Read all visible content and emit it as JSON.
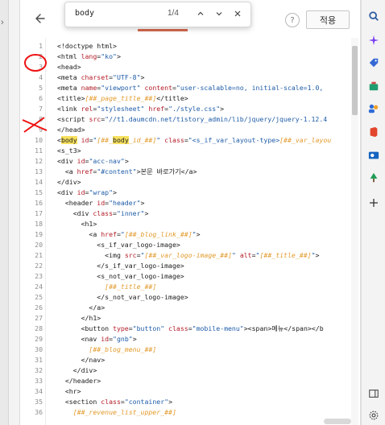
{
  "search": {
    "query": "body",
    "match_count": "1/4"
  },
  "toolbar": {
    "help_label": "?",
    "apply_label": "적용"
  },
  "code_lines": [
    {
      "n": "1",
      "tokens": [
        {
          "t": "tag",
          "v": "<!doctype html>"
        }
      ]
    },
    {
      "n": "2",
      "tokens": [
        {
          "t": "tag",
          "v": "<html "
        },
        {
          "t": "attr",
          "v": "lang"
        },
        {
          "t": "tag",
          "v": "="
        },
        {
          "t": "val",
          "v": "\"ko\""
        },
        {
          "t": "tag",
          "v": ">"
        }
      ]
    },
    {
      "n": "3",
      "tokens": [
        {
          "t": "tag",
          "v": "<head>"
        }
      ]
    },
    {
      "n": "4",
      "tokens": [
        {
          "t": "tag",
          "v": "<meta "
        },
        {
          "t": "attr",
          "v": "charset"
        },
        {
          "t": "tag",
          "v": "="
        },
        {
          "t": "val",
          "v": "\"UTF-8\""
        },
        {
          "t": "tag",
          "v": ">"
        }
      ]
    },
    {
      "n": "5",
      "tokens": [
        {
          "t": "tag",
          "v": "<meta "
        },
        {
          "t": "attr",
          "v": "name"
        },
        {
          "t": "tag",
          "v": "="
        },
        {
          "t": "val",
          "v": "\"viewport\""
        },
        {
          "t": "tag",
          "v": " "
        },
        {
          "t": "attr",
          "v": "content"
        },
        {
          "t": "tag",
          "v": "="
        },
        {
          "t": "val",
          "v": "\"user-scalable=no, initial-scale=1.0,"
        }
      ]
    },
    {
      "n": "6",
      "tokens": [
        {
          "t": "tag",
          "v": "<title>"
        },
        {
          "t": "tpl",
          "v": "[##_page_title_##]"
        },
        {
          "t": "tag",
          "v": "</title>"
        }
      ]
    },
    {
      "n": "7",
      "tokens": [
        {
          "t": "tag",
          "v": "<link "
        },
        {
          "t": "attr",
          "v": "rel"
        },
        {
          "t": "tag",
          "v": "="
        },
        {
          "t": "val",
          "v": "\"stylesheet\""
        },
        {
          "t": "tag",
          "v": " "
        },
        {
          "t": "attr",
          "v": "href"
        },
        {
          "t": "tag",
          "v": "="
        },
        {
          "t": "val",
          "v": "\"./style.css\""
        },
        {
          "t": "tag",
          "v": ">"
        }
      ]
    },
    {
      "n": "8",
      "tokens": [
        {
          "t": "tag",
          "v": "<script "
        },
        {
          "t": "attr",
          "v": "src"
        },
        {
          "t": "tag",
          "v": "="
        },
        {
          "t": "val",
          "v": "\"//t1.daumcdn.net/tistory_admin/lib/jquery/jquery-1.12.4"
        }
      ]
    },
    {
      "n": "9",
      "tokens": [
        {
          "t": "tag",
          "v": "</head>"
        }
      ]
    },
    {
      "n": "10",
      "tokens": [
        {
          "t": "tag",
          "v": "<"
        },
        {
          "t": "hl",
          "v": "body"
        },
        {
          "t": "tag",
          "v": " "
        },
        {
          "t": "attr",
          "v": "id"
        },
        {
          "t": "tag",
          "v": "="
        },
        {
          "t": "val",
          "v": "\""
        },
        {
          "t": "tpl",
          "v": "[##_"
        },
        {
          "t": "hl",
          "v": "body"
        },
        {
          "t": "tpl",
          "v": "_id_##]"
        },
        {
          "t": "val",
          "v": "\""
        },
        {
          "t": "tag",
          "v": " "
        },
        {
          "t": "attr",
          "v": "class"
        },
        {
          "t": "tag",
          "v": "="
        },
        {
          "t": "val",
          "v": "\"<s_if_var_layout-type>"
        },
        {
          "t": "tpl",
          "v": "[##_var_layou"
        }
      ]
    },
    {
      "n": "11",
      "tokens": [
        {
          "t": "tag",
          "v": "<s_t3>"
        }
      ]
    },
    {
      "n": "12",
      "tokens": [
        {
          "t": "tag",
          "v": "<div "
        },
        {
          "t": "attr",
          "v": "id"
        },
        {
          "t": "tag",
          "v": "="
        },
        {
          "t": "val",
          "v": "\"acc-nav\""
        },
        {
          "t": "tag",
          "v": ">"
        }
      ]
    },
    {
      "n": "13",
      "tokens": [
        {
          "t": "tag",
          "v": "  <a "
        },
        {
          "t": "attr",
          "v": "href"
        },
        {
          "t": "tag",
          "v": "="
        },
        {
          "t": "val",
          "v": "\"#content\""
        },
        {
          "t": "tag",
          "v": ">"
        },
        {
          "t": "text",
          "v": "본문 바로가기"
        },
        {
          "t": "tag",
          "v": "</a>"
        }
      ]
    },
    {
      "n": "14",
      "tokens": [
        {
          "t": "tag",
          "v": "</div>"
        }
      ]
    },
    {
      "n": "15",
      "tokens": [
        {
          "t": "tag",
          "v": "<div "
        },
        {
          "t": "attr",
          "v": "id"
        },
        {
          "t": "tag",
          "v": "="
        },
        {
          "t": "val",
          "v": "\"wrap\""
        },
        {
          "t": "tag",
          "v": ">"
        }
      ]
    },
    {
      "n": "16",
      "tokens": [
        {
          "t": "tag",
          "v": "  <header "
        },
        {
          "t": "attr",
          "v": "id"
        },
        {
          "t": "tag",
          "v": "="
        },
        {
          "t": "val",
          "v": "\"header\""
        },
        {
          "t": "tag",
          "v": ">"
        }
      ]
    },
    {
      "n": "17",
      "tokens": [
        {
          "t": "tag",
          "v": "    <div "
        },
        {
          "t": "attr",
          "v": "class"
        },
        {
          "t": "tag",
          "v": "="
        },
        {
          "t": "val",
          "v": "\"inner\""
        },
        {
          "t": "tag",
          "v": ">"
        }
      ]
    },
    {
      "n": "18",
      "tokens": [
        {
          "t": "tag",
          "v": "      <h1>"
        }
      ]
    },
    {
      "n": "19",
      "tokens": [
        {
          "t": "tag",
          "v": "        <a "
        },
        {
          "t": "attr",
          "v": "href"
        },
        {
          "t": "tag",
          "v": "="
        },
        {
          "t": "val",
          "v": "\""
        },
        {
          "t": "tpl",
          "v": "[##_blog_link_##]"
        },
        {
          "t": "val",
          "v": "\""
        },
        {
          "t": "tag",
          "v": ">"
        }
      ]
    },
    {
      "n": "20",
      "tokens": [
        {
          "t": "tag",
          "v": "          <s_if_var_logo-image>"
        }
      ]
    },
    {
      "n": "21",
      "tokens": [
        {
          "t": "tag",
          "v": "            <img "
        },
        {
          "t": "attr",
          "v": "src"
        },
        {
          "t": "tag",
          "v": "="
        },
        {
          "t": "val",
          "v": "\""
        },
        {
          "t": "tpl",
          "v": "[##_var_logo-image_##]"
        },
        {
          "t": "val",
          "v": "\""
        },
        {
          "t": "tag",
          "v": " "
        },
        {
          "t": "attr",
          "v": "alt"
        },
        {
          "t": "tag",
          "v": "="
        },
        {
          "t": "val",
          "v": "\""
        },
        {
          "t": "tpl",
          "v": "[##_title_##]"
        },
        {
          "t": "val",
          "v": "\""
        },
        {
          "t": "tag",
          "v": ">"
        }
      ]
    },
    {
      "n": "22",
      "tokens": [
        {
          "t": "tag",
          "v": "          </s_if_var_logo-image>"
        }
      ]
    },
    {
      "n": "23",
      "tokens": [
        {
          "t": "tag",
          "v": "          <s_not_var_logo-image>"
        }
      ]
    },
    {
      "n": "24",
      "tokens": [
        {
          "t": "tpl",
          "v": "            [##_title_##]"
        }
      ]
    },
    {
      "n": "25",
      "tokens": [
        {
          "t": "tag",
          "v": "          </s_not_var_logo-image>"
        }
      ]
    },
    {
      "n": "26",
      "tokens": [
        {
          "t": "tag",
          "v": "        </a>"
        }
      ]
    },
    {
      "n": "27",
      "tokens": [
        {
          "t": "tag",
          "v": "      </h1>"
        }
      ]
    },
    {
      "n": "28",
      "tokens": [
        {
          "t": "tag",
          "v": "      <button "
        },
        {
          "t": "attr",
          "v": "type"
        },
        {
          "t": "tag",
          "v": "="
        },
        {
          "t": "val",
          "v": "\"button\""
        },
        {
          "t": "tag",
          "v": " "
        },
        {
          "t": "attr",
          "v": "class"
        },
        {
          "t": "tag",
          "v": "="
        },
        {
          "t": "val",
          "v": "\"mobile-menu\""
        },
        {
          "t": "tag",
          "v": ">"
        },
        {
          "t": "tag",
          "v": "<span>"
        },
        {
          "t": "text",
          "v": "메뉴"
        },
        {
          "t": "tag",
          "v": "</span></b"
        }
      ]
    },
    {
      "n": "29",
      "tokens": [
        {
          "t": "tag",
          "v": "      <nav "
        },
        {
          "t": "attr",
          "v": "id"
        },
        {
          "t": "tag",
          "v": "="
        },
        {
          "t": "val",
          "v": "\"gnb\""
        },
        {
          "t": "tag",
          "v": ">"
        }
      ]
    },
    {
      "n": "30",
      "tokens": [
        {
          "t": "tpl",
          "v": "        [##_blog_menu_##]"
        }
      ]
    },
    {
      "n": "31",
      "tokens": [
        {
          "t": "tag",
          "v": "      </nav>"
        }
      ]
    },
    {
      "n": "32",
      "tokens": [
        {
          "t": "tag",
          "v": "    </div>"
        }
      ]
    },
    {
      "n": "33",
      "tokens": [
        {
          "t": "tag",
          "v": "  </header>"
        }
      ]
    },
    {
      "n": "34",
      "tokens": [
        {
          "t": "tag",
          "v": "  <hr>"
        }
      ]
    },
    {
      "n": "35",
      "tokens": [
        {
          "t": "tag",
          "v": "  <section "
        },
        {
          "t": "attr",
          "v": "class"
        },
        {
          "t": "tag",
          "v": "="
        },
        {
          "t": "val",
          "v": "\"container\""
        },
        {
          "t": "tag",
          "v": ">"
        }
      ]
    },
    {
      "n": "36",
      "tokens": [
        {
          "t": "tpl",
          "v": "    [##_revenue_list_upper_##]"
        }
      ]
    }
  ],
  "right_sidebar": {
    "icons": [
      "search-icon",
      "sparkle-icon",
      "tag-icon",
      "toolbox-icon",
      "people-icon",
      "office-icon",
      "outlook-icon",
      "tree-icon",
      "plus-icon",
      "panel-icon",
      "settings-icon"
    ]
  },
  "colors": {
    "tab_indicator": "#d26a50",
    "highlight": "#f6e05e",
    "tag": "#202020",
    "attr": "#b31d28",
    "val": "#1f5ca8",
    "tpl": "#e39a2b"
  }
}
